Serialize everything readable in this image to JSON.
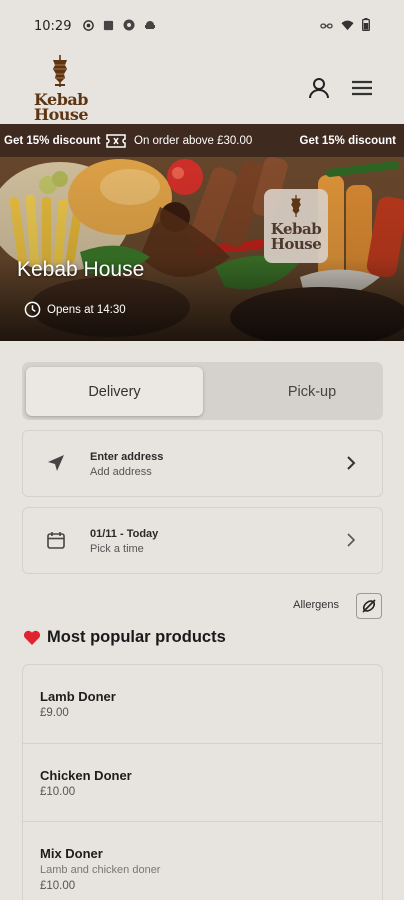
{
  "status_bar": {
    "time": "10:29"
  },
  "header": {
    "logo_line1": "Kebab",
    "logo_line2": "House"
  },
  "promo": {
    "left": "Get 15% discount",
    "middle": "On order above £30.00",
    "right": "Get 15% discount"
  },
  "hero": {
    "restaurant_name": "Kebab House",
    "opening": "Opens at 14:30",
    "badge_line1": "Kebab",
    "badge_line2": "House"
  },
  "order_mode": {
    "delivery_label": "Delivery",
    "pickup_label": "Pick-up",
    "selected": "Delivery"
  },
  "address": {
    "title": "Enter address",
    "subtitle": "Add address"
  },
  "time": {
    "title": "01/11 - Today",
    "subtitle": "Pick a time"
  },
  "allergens": {
    "label": "Allergens"
  },
  "popular": {
    "title": "Most popular products",
    "products": [
      {
        "name": "Lamb Doner",
        "description": "",
        "price": "£9.00"
      },
      {
        "name": "Chicken Doner",
        "description": "",
        "price": "£10.00"
      },
      {
        "name": "Mix Doner",
        "description": "Lamb and chicken doner",
        "price": "£10.00"
      }
    ]
  },
  "colors": {
    "background": "#e7e3df",
    "promo_bar": "#3f2a1f",
    "brand_brown": "#5d3513",
    "heart": "#e0242d"
  }
}
